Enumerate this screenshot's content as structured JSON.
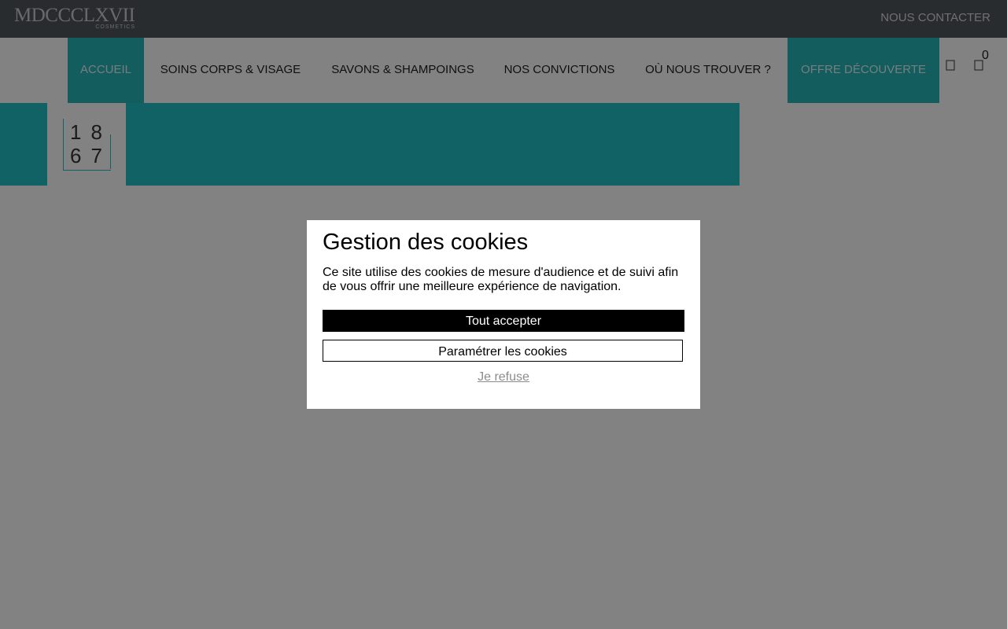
{
  "header": {
    "brand_name": "MDCCCLXVII",
    "brand_subtitle": "COSMETICS",
    "contact_label": "NOUS CONTACTER"
  },
  "nav": {
    "items": [
      {
        "label": "ACCUEIL",
        "active": true
      },
      {
        "label": "SOINS CORPS & VISAGE"
      },
      {
        "label": "SAVONS & SHAMPOINGS"
      },
      {
        "label": "NOS CONVICTIONS"
      },
      {
        "label": "OÙ NOUS TROUVER ?"
      },
      {
        "label": "OFFRE DÉCOUVERTE",
        "highlighted": true
      }
    ],
    "icons": [
      "user-icon",
      "cart-icon"
    ],
    "cart_count": "0"
  },
  "banner": {
    "logo_line1": "18",
    "logo_line2": "67"
  },
  "cookie_modal": {
    "title": "Gestion des cookies",
    "text": "Ce site utilise des cookies de mesure d'audience et de suivi afin de vous offrir une meilleure expérience de navigation.",
    "accept_label": "Tout accepter",
    "settings_label": "Paramétrer les cookies",
    "refuse_label": "Je refuse"
  },
  "colors": {
    "accent": "#20c0c6",
    "topbar": "#52565c",
    "overlay": "rgba(0,0,0,0.49)"
  }
}
